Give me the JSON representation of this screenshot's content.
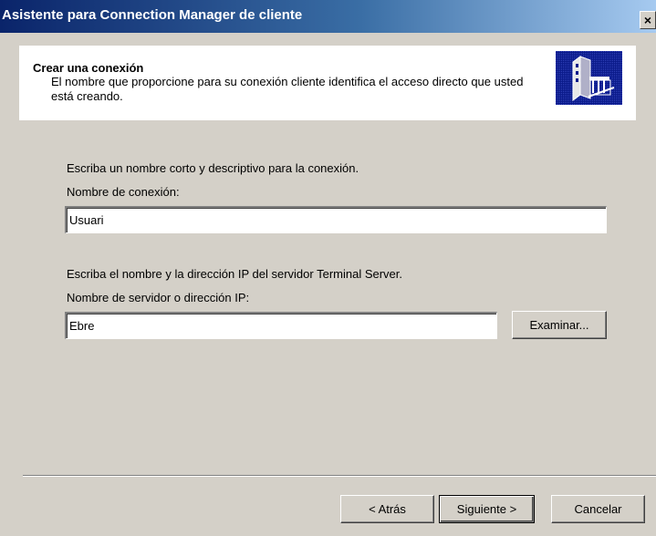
{
  "window": {
    "title": "Asistente para Connection Manager de cliente",
    "close_glyph": "×"
  },
  "header": {
    "title": "Crear una conexión",
    "description": "El nombre que proporcione para su conexión cliente identifica el acceso directo que usted está creando.",
    "icon": "connection-wizard-icon"
  },
  "connection": {
    "instruction": "Escriba un nombre corto y descriptivo para la conexión.",
    "field_label": "Nombre de conexión:",
    "field_value": "Usuari"
  },
  "server": {
    "instruction": "Escriba el nombre y la dirección IP del servidor Terminal Server.",
    "field_label": "Nombre de servidor o dirección IP:",
    "field_value": "Ebre",
    "browse_label": "Examinar..."
  },
  "footer": {
    "back_label": "< Atrás",
    "next_label": "Siguiente >",
    "cancel_label": "Cancelar"
  },
  "colors": {
    "titlebar_start": "#0a246a",
    "titlebar_end": "#a6caf0",
    "dialog_face": "#d4d0c8",
    "icon_background": "#0a1a8a"
  }
}
